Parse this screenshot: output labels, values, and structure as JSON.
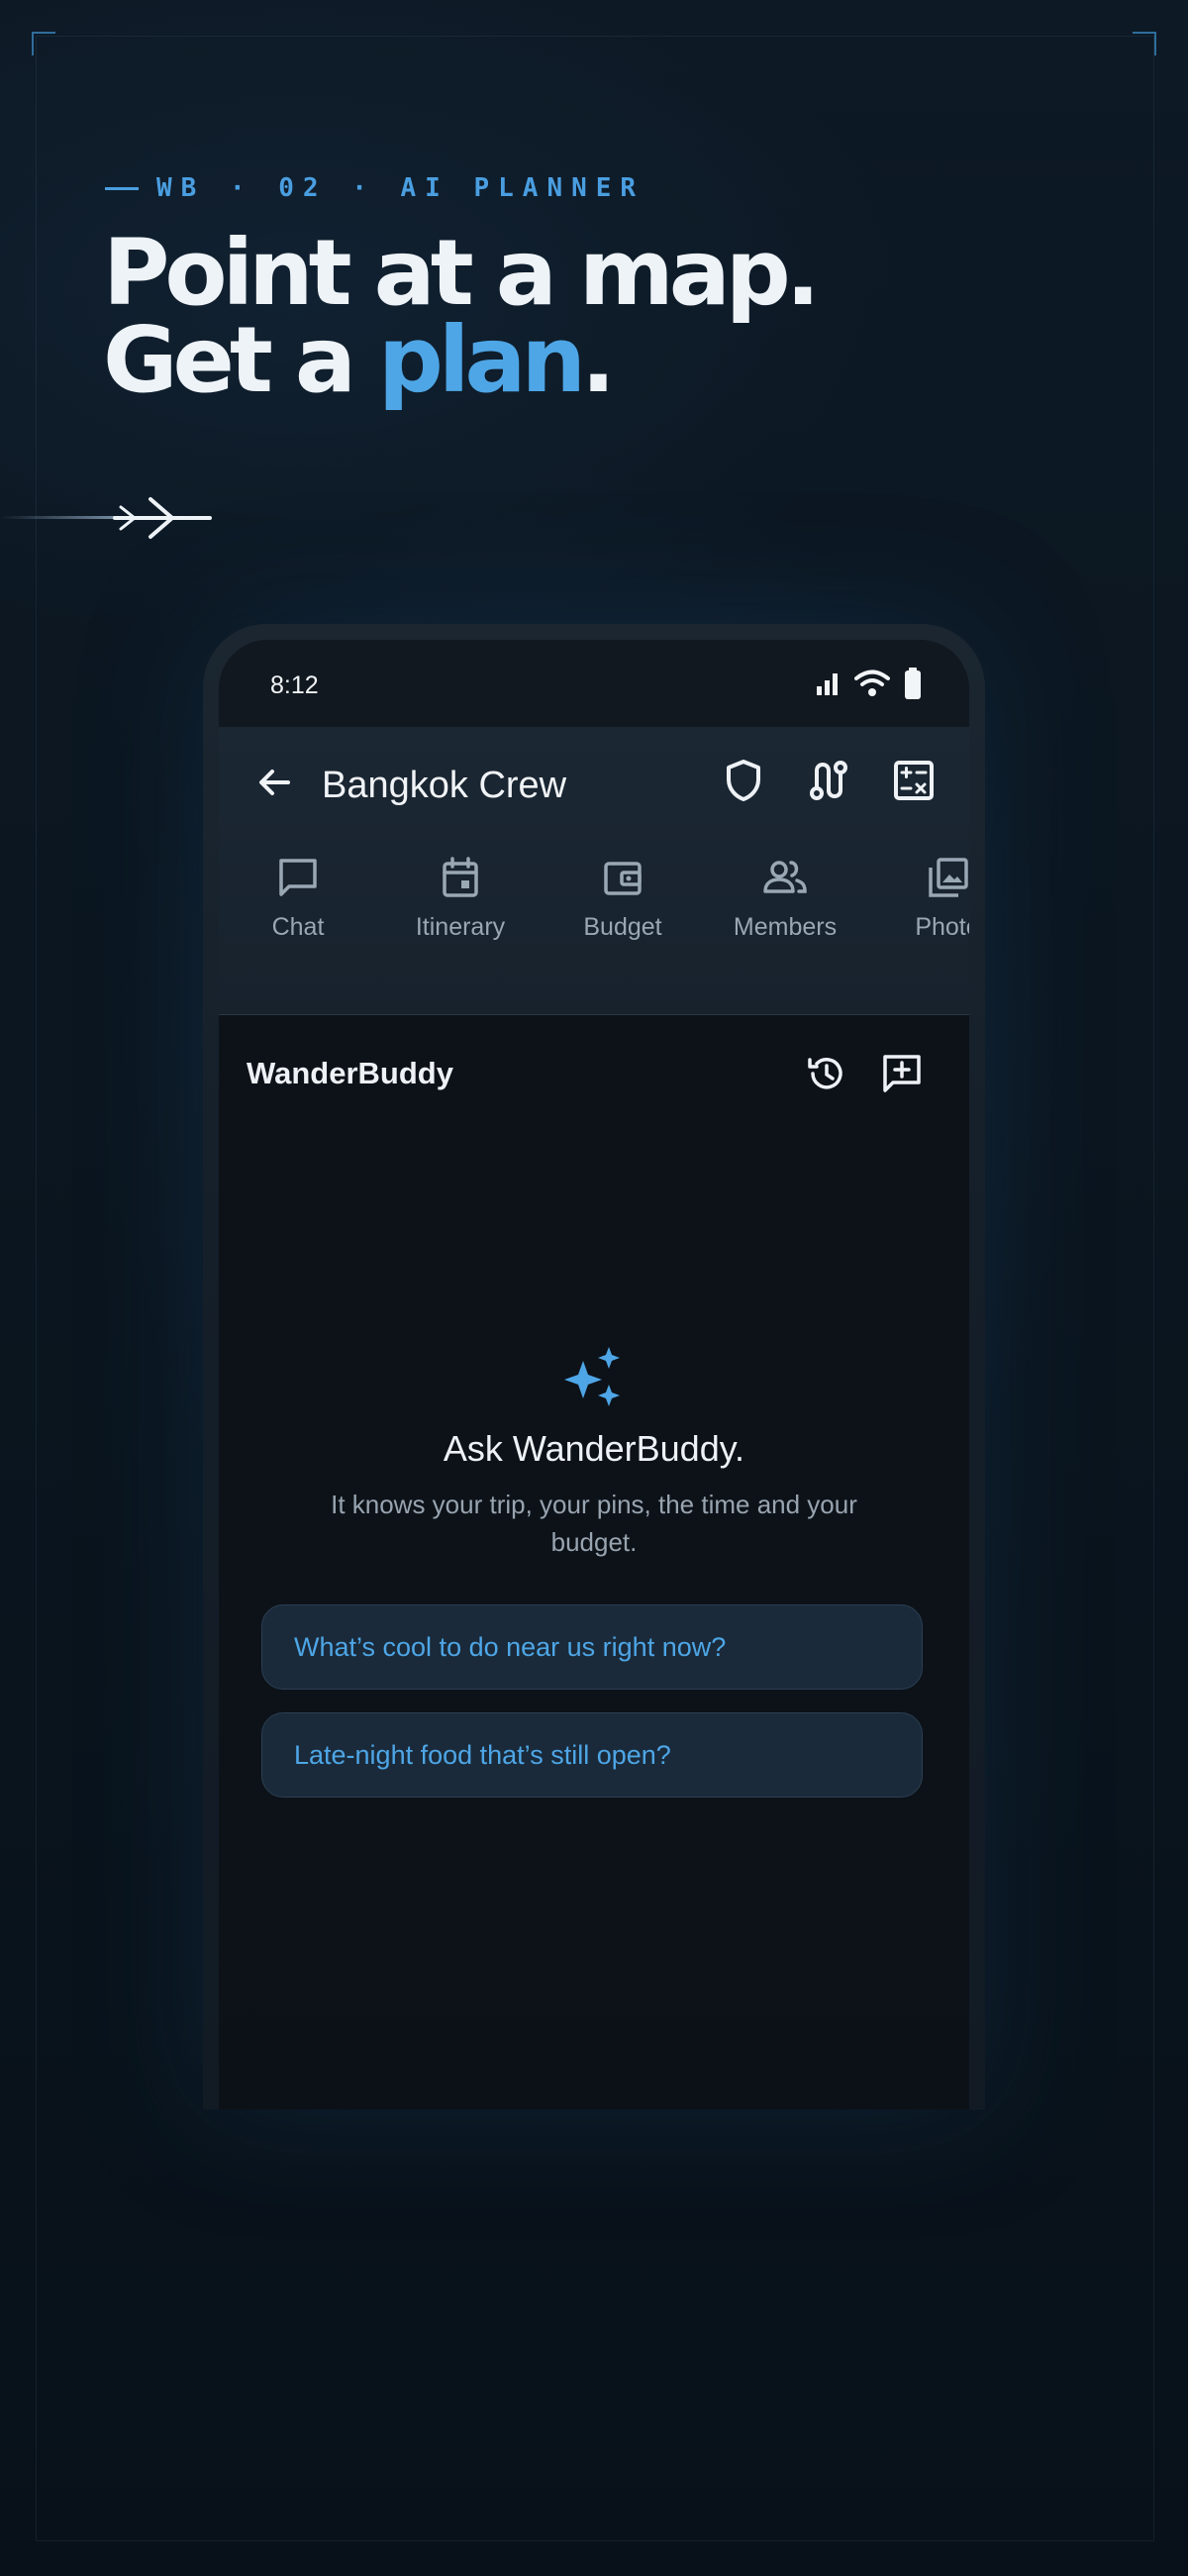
{
  "header": {
    "eyebrow": "WB · 02 · AI PLANNER",
    "headline_line1": "Point at a map.",
    "headline_line2_before": "Get a ",
    "headline_line2_accent": "plan",
    "headline_line2_after": "."
  },
  "colors": {
    "accent": "#4ea6e6",
    "background": "#0a141d",
    "chip_bg": "#1a2a3a"
  },
  "status_bar": {
    "time": "8:12",
    "icons": [
      "signal-icon",
      "wifi-icon",
      "battery-icon"
    ]
  },
  "app_bar": {
    "title": "Bangkok Crew",
    "back_icon": "arrow-left-icon",
    "actions": [
      "shield-icon",
      "route-icon",
      "calculator-icon"
    ]
  },
  "tabs": [
    {
      "label": "Chat",
      "icon": "chat-icon"
    },
    {
      "label": "Itinerary",
      "icon": "calendar-icon"
    },
    {
      "label": "Budget",
      "icon": "wallet-icon"
    },
    {
      "label": "Members",
      "icon": "people-icon"
    },
    {
      "label": "Photo",
      "icon": "photos-icon"
    }
  ],
  "assistant": {
    "name": "WanderBuddy",
    "actions": [
      "history-icon",
      "new-chat-icon"
    ],
    "empty_icon": "sparkle-icon",
    "empty_title": "Ask WanderBuddy.",
    "empty_subtitle": "It knows your trip, your pins, the time and your budget.",
    "suggestions": [
      "What’s cool to do near us right now?",
      "Late-night food that’s still open?"
    ]
  }
}
